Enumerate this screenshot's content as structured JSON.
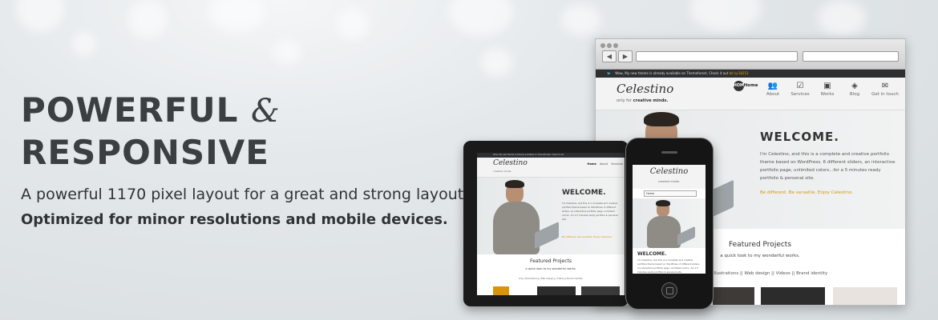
{
  "hero": {
    "title_line1": "POWERFUL",
    "amp": "&",
    "title_line2": "RESPONSIVE",
    "subtitle_line1": "A powerful 1170 pixel layout for a great and strong layout.",
    "subtitle_line2": "Optimized for minor resolutions and mobile devices."
  },
  "mock_site": {
    "twitter_text": "Wow, My new theme is already available on Themeforest, Check it out",
    "twitter_link": "bit.ly/18253",
    "logo": "Celestino",
    "tagline_prefix": "only for",
    "tagline_bold": "creative minds.",
    "menu": [
      {
        "label": "Home",
        "icon": "home-icon",
        "glyph": "HOME"
      },
      {
        "label": "About",
        "icon": "people-icon",
        "glyph": "👥"
      },
      {
        "label": "Services",
        "icon": "checklist-icon",
        "glyph": "☑"
      },
      {
        "label": "Works",
        "icon": "picture-icon",
        "glyph": "▣"
      },
      {
        "label": "Blog",
        "icon": "tag-icon",
        "glyph": "◈"
      },
      {
        "label": "Get in touch",
        "icon": "envelope-icon",
        "glyph": "✉"
      }
    ],
    "welcome_title": "WELCOME.",
    "welcome_text": "I'm Celestino, and this is a complete and creative portfolio theme based on WordPress. 6 different sliders, an interactive portfolio page, unlimited colors...for a 5 minutes ready portfolio & personal site.",
    "welcome_text_short": "I'm Celestino, and this is a complete and creative portfolio theme based on WordPress. 6 different sliders, an interactive portfolio page, unlimited colors...for a 5 minutes ready portfolio & personal site.",
    "welcome_link": "Be different.  Be versatile.  Enjoy Celestino.",
    "featured_title": "Featured Projects",
    "featured_sub": "a quick look to my wonderful works.",
    "filters": "Illustrations  ||  Web design  ||  Videos  ||  Brand identity",
    "filters_tablet": "All  ||  Illustrations  ||  Web design  ||  Videos  ||  Brand identity",
    "phone_select": "Home"
  },
  "colors": {
    "accent": "#d9950a",
    "heading": "#3b3f42",
    "device_frame": "#1a1a1a"
  }
}
